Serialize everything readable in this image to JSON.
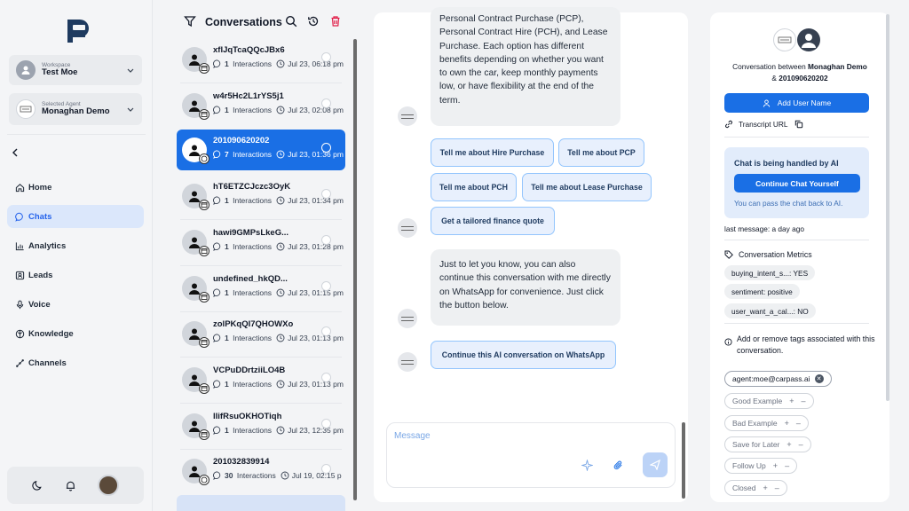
{
  "sidebar": {
    "workspace_label": "Workspace",
    "workspace_value": "Test Moe",
    "agent_label": "Selected Agent",
    "agent_value": "Monaghan Demo",
    "items": [
      {
        "label": "Home",
        "icon": "home-icon"
      },
      {
        "label": "Chats",
        "icon": "chat-icon",
        "active": true
      },
      {
        "label": "Analytics",
        "icon": "analytics-icon"
      },
      {
        "label": "Leads",
        "icon": "leads-icon"
      },
      {
        "label": "Voice",
        "icon": "mic-icon"
      },
      {
        "label": "Knowledge",
        "icon": "knowledge-icon"
      },
      {
        "label": "Channels",
        "icon": "channels-icon"
      }
    ]
  },
  "list": {
    "title": "Conversations",
    "conversations": [
      {
        "name": "xflJqTcaQQcJBx6",
        "count": "1",
        "time": "Jul 23, 06:18 pm",
        "channel": "web"
      },
      {
        "name": "w4r5Hc2L1rYS5j1",
        "count": "1",
        "time": "Jul 23, 02:08 pm",
        "channel": "web"
      },
      {
        "name": "201090620202",
        "count": "7",
        "time": "Jul 23, 01:36 pm",
        "channel": "whatsapp",
        "active": true
      },
      {
        "name": "hT6ETZCJczc3OyK",
        "count": "1",
        "time": "Jul 23, 01:34 pm",
        "channel": "web"
      },
      {
        "name": "hawi9GMPsLkeG...",
        "count": "1",
        "time": "Jul 23, 01:28 pm",
        "channel": "web"
      },
      {
        "name": "undefined_hkQD...",
        "count": "1",
        "time": "Jul 23, 01:15 pm",
        "channel": "web"
      },
      {
        "name": "zolPKqQI7QHOWXo",
        "count": "1",
        "time": "Jul 23, 01:13 pm",
        "channel": "web"
      },
      {
        "name": "VCPuDDrtziiLO4B",
        "count": "1",
        "time": "Jul 23, 01:13 pm",
        "channel": "web"
      },
      {
        "name": "lIifRsuOKHOTiqh",
        "count": "1",
        "time": "Jul 23, 12:35 pm",
        "channel": "web"
      },
      {
        "name": "201032839914",
        "count": "30",
        "time": "Jul 19, 02:15 p",
        "channel": "whatsapp"
      }
    ],
    "interactions_label": "Interactions"
  },
  "chat": {
    "bubble1": "Personal Contract Purchase (PCP), Personal Contract Hire (PCH), and Lease Purchase. Each option has different benefits depending on whether you want to own the car, keep monthly payments low, or have flexibility at the end of the term.",
    "quick": [
      "Tell me about Hire Purchase",
      "Tell me about PCP",
      "Tell me about PCH",
      "Tell me about Lease Purchase",
      "Get a tailored finance quote"
    ],
    "bubble2": "Just to let you know, you can also continue this conversation with me directly on WhatsApp for convenience. Just click the button below.",
    "whatsapp_button": "Continue this AI conversation on WhatsApp",
    "message_placeholder": "Message"
  },
  "details": {
    "between_prefix": "Conversation between",
    "agent": "Monaghan Demo",
    "between_and": "&",
    "contact": "201090620202",
    "add_user": "Add User Name",
    "transcript": "Transcript URL",
    "ai_title": "Chat is being handled by AI",
    "ai_button": "Continue Chat Yourself",
    "ai_sub": "You can pass the chat back to AI.",
    "last_message": "last message: a day ago",
    "metrics_title": "Conversation Metrics",
    "metrics": [
      "buying_intent_s...: YES",
      "sentiment: positive",
      "user_want_a_cal...: NO"
    ],
    "tags_info": "Add or remove tags associated with this conversation.",
    "active_tag": "agent:moe@carpass.ai",
    "tags": [
      "Good Example",
      "Bad Example",
      "Save for Later",
      "Follow Up",
      "Closed"
    ],
    "plus": "+",
    "minus": "–"
  },
  "colors": {
    "accent": "#1a6fe5",
    "active_nav_bg": "#dbe7fb",
    "ai_box_bg": "#e2ecfb"
  }
}
